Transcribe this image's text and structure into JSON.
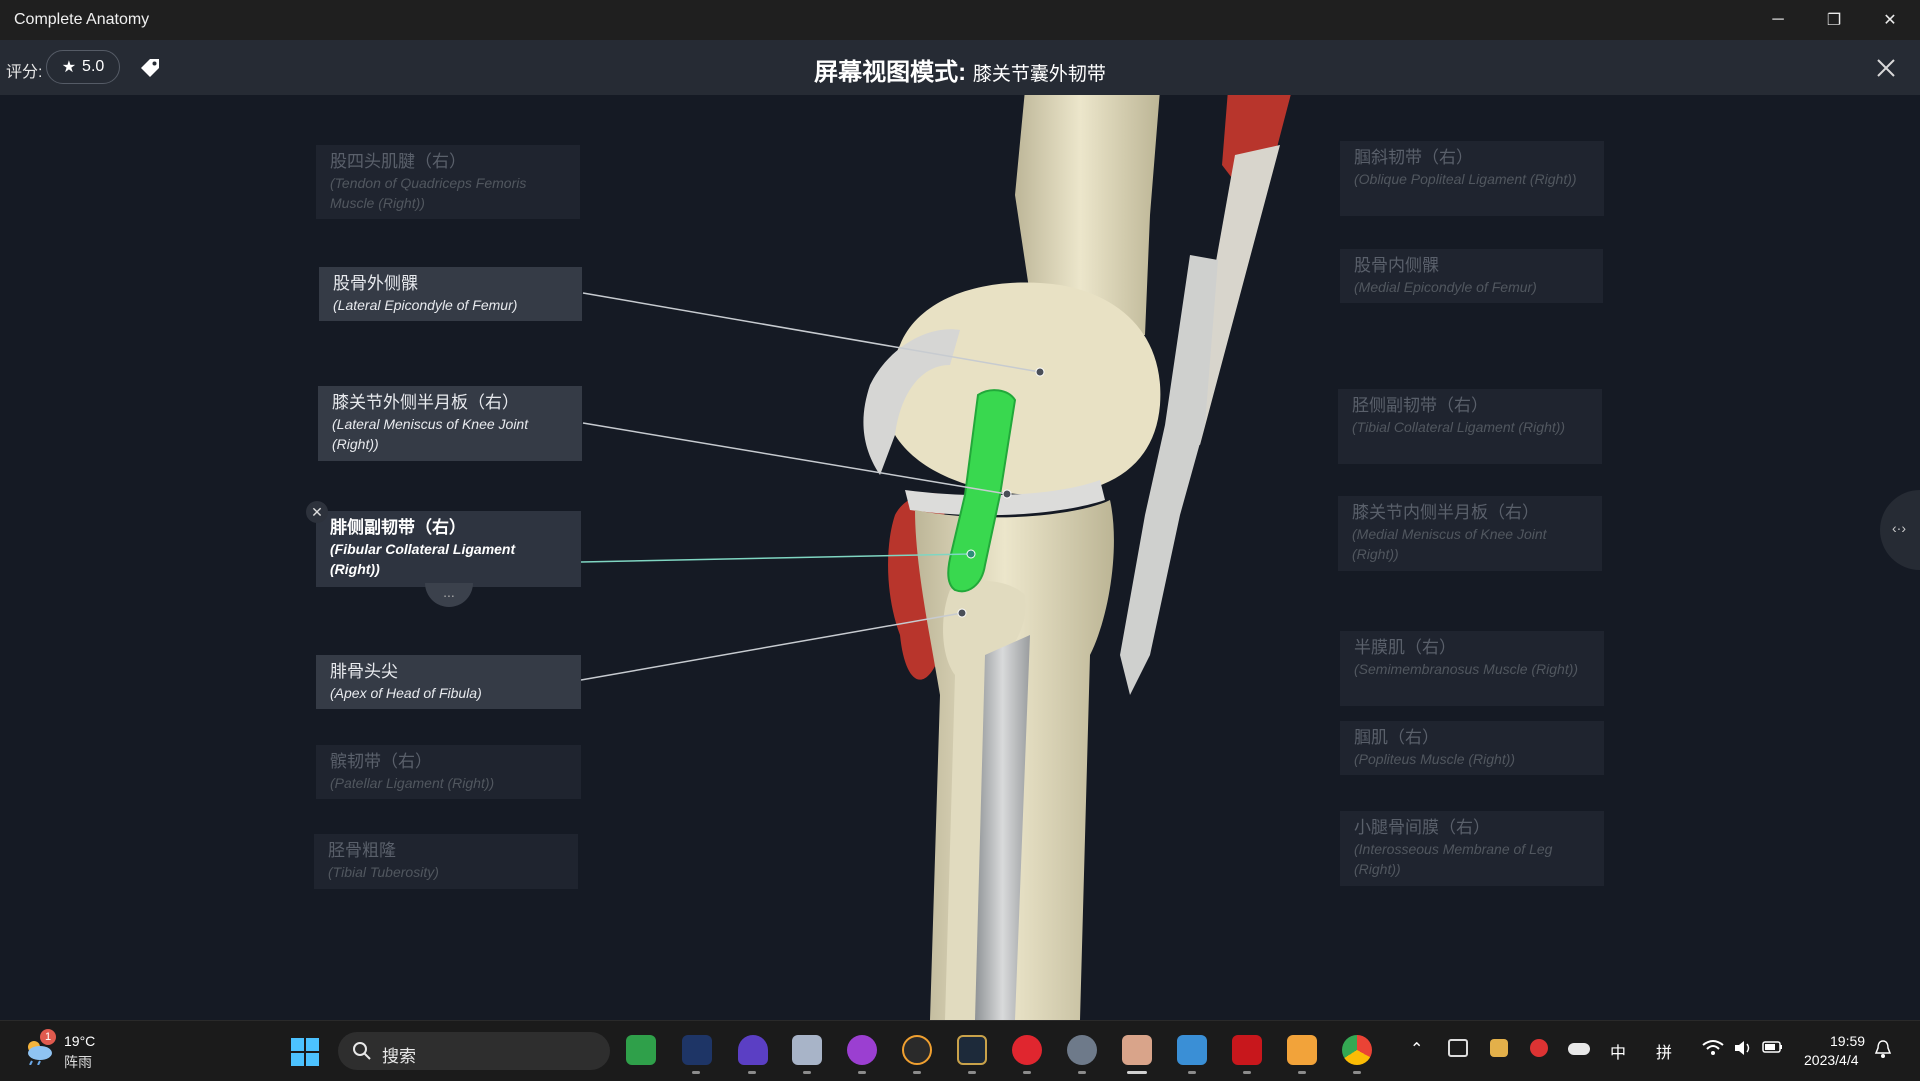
{
  "window": {
    "title": "Complete Anatomy",
    "minimize_glyph": "─",
    "maximize_glyph": "❐",
    "close_glyph": "✕"
  },
  "toolbar": {
    "rating_label": "评分:",
    "rating_star": "★",
    "rating_value": "5.0",
    "title_main": "屏幕视图模式: ",
    "title_sub": "膝关节囊外韧带",
    "close_glyph": "✕"
  },
  "labels_left": [
    {
      "zh": "股四头肌腱（右）",
      "en": "(Tendon of Quadriceps Femoris Muscle (Right))",
      "state": "faded"
    },
    {
      "zh": "股骨外侧髁",
      "en": "(Lateral Epicondyle of Femur)",
      "state": "active"
    },
    {
      "zh": "膝关节外侧半月板（右）",
      "en": "(Lateral Meniscus of Knee Joint (Right))",
      "state": "active"
    },
    {
      "zh": "腓侧副韧带（右）",
      "en": "(Fibular Collateral Ligament (Right))",
      "state": "selected"
    },
    {
      "zh": "腓骨头尖",
      "en": "(Apex of Head of Fibula)",
      "state": "active"
    },
    {
      "zh": "髌韧带（右）",
      "en": "(Patellar Ligament (Right))",
      "state": "faded"
    },
    {
      "zh": "胫骨粗隆",
      "en": "(Tibial Tuberosity)",
      "state": "faded"
    }
  ],
  "labels_right": [
    {
      "zh": "腘斜韧带（右）",
      "en": "(Oblique Popliteal Ligament (Right))",
      "state": "faded"
    },
    {
      "zh": "股骨内侧髁",
      "en": "(Medial Epicondyle of Femur)",
      "state": "faded"
    },
    {
      "zh": "胫侧副韧带（右）",
      "en": "(Tibial Collateral Ligament (Right))",
      "state": "faded"
    },
    {
      "zh": "膝关节内侧半月板（右）",
      "en": "(Medial Meniscus of Knee Joint (Right))",
      "state": "faded"
    },
    {
      "zh": "半膜肌（右）",
      "en": "(Semimembranosus Muscle (Right))",
      "state": "faded"
    },
    {
      "zh": "腘肌（右）",
      "en": "(Popliteus Muscle (Right))",
      "state": "faded"
    },
    {
      "zh": "小腿骨间膜（右）",
      "en": "(Interosseous Membrane of Leg (Right))",
      "state": "faded"
    }
  ],
  "selected_label_controls": {
    "close_glyph": "✕",
    "more_glyph": "..."
  },
  "side_handle_glyph": "‹·›",
  "taskbar": {
    "weather_badge": "1",
    "weather_temp": "19°C",
    "weather_condition": "阵雨",
    "search_placeholder": "搜索",
    "ime_mode": "中",
    "ime_layout": "拼",
    "time": "19:59",
    "date": "2023/4/4"
  },
  "colors": {
    "highlight_ligament": "#39d84f",
    "leader_selected": "#7fd6c2",
    "leader_default": "#c7cbd0",
    "bone": "#e6e0c4",
    "muscle": "#b8352c"
  }
}
